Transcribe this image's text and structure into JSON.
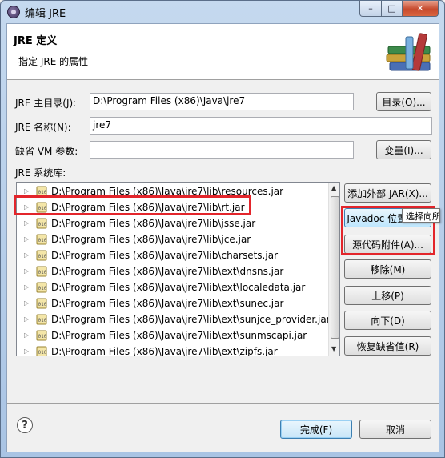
{
  "window": {
    "title": "编辑 JRE",
    "min": "–",
    "max": "□",
    "close": "✕"
  },
  "header": {
    "title": "JRE 定义",
    "description": "指定 JRE 的属性"
  },
  "form": {
    "home_label": "JRE 主目录(J):",
    "home_value": "D:\\Program Files (x86)\\Java\\jre7",
    "home_button": "目录(O)...",
    "name_label": "JRE 名称(N):",
    "name_value": "jre7",
    "vmargs_label": "缺省 VM 参数:",
    "vmargs_value": "",
    "vmargs_button": "变量(I)...",
    "libs_label": "JRE 系统库:"
  },
  "libraries": [
    "D:\\Program Files (x86)\\Java\\jre7\\lib\\resources.jar",
    "D:\\Program Files (x86)\\Java\\jre7\\lib\\rt.jar",
    "D:\\Program Files (x86)\\Java\\jre7\\lib\\jsse.jar",
    "D:\\Program Files (x86)\\Java\\jre7\\lib\\jce.jar",
    "D:\\Program Files (x86)\\Java\\jre7\\lib\\charsets.jar",
    "D:\\Program Files (x86)\\Java\\jre7\\lib\\ext\\dnsns.jar",
    "D:\\Program Files (x86)\\Java\\jre7\\lib\\ext\\localedata.jar",
    "D:\\Program Files (x86)\\Java\\jre7\\lib\\ext\\sunec.jar",
    "D:\\Program Files (x86)\\Java\\jre7\\lib\\ext\\sunjce_provider.jar",
    "D:\\Program Files (x86)\\Java\\jre7\\lib\\ext\\sunmscapi.jar",
    "D:\\Program Files (x86)\\Java\\jre7\\lib\\ext\\zipfs.jar"
  ],
  "side_buttons": {
    "add_external_jars": "添加外部 JAR(X)...",
    "javadoc_location": "Javadoc 位置(L)...",
    "source_attachment": "源代码附件(A)...",
    "remove": "移除(M)",
    "up": "上移(P)",
    "down": "向下(D)",
    "restore_default": "恢复缺省值(R)"
  },
  "tooltip": "选择向所",
  "footer": {
    "help": "?",
    "finish": "完成(F)",
    "cancel": "取消"
  },
  "colors": {
    "highlight": "#e3252b",
    "accent": "#3c7fb1"
  }
}
